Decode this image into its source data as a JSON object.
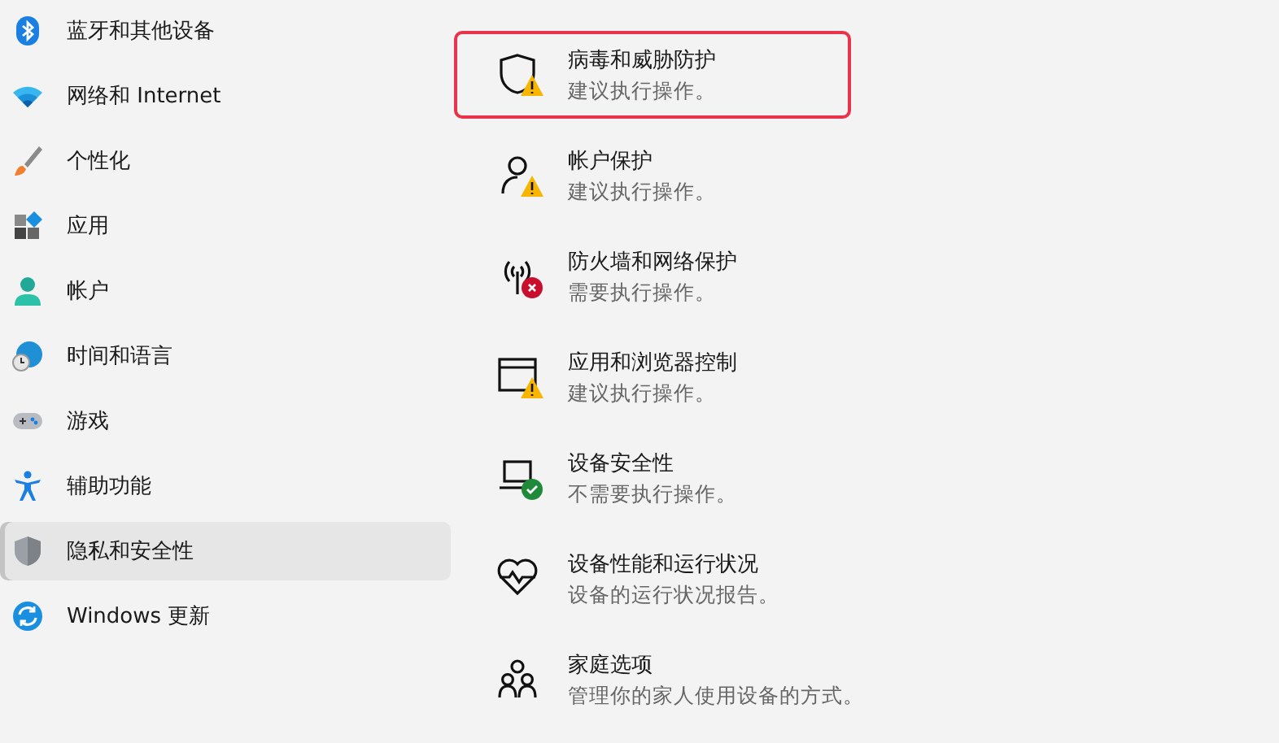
{
  "sidebar": {
    "items": [
      {
        "label": "蓝牙和其他设备",
        "kind": "bluetooth",
        "selected": false
      },
      {
        "label": "网络和 Internet",
        "kind": "wifi",
        "selected": false
      },
      {
        "label": "个性化",
        "kind": "brush",
        "selected": false
      },
      {
        "label": "应用",
        "kind": "apps",
        "selected": false
      },
      {
        "label": "帐户",
        "kind": "account",
        "selected": false
      },
      {
        "label": "时间和语言",
        "kind": "time",
        "selected": false
      },
      {
        "label": "游戏",
        "kind": "gaming",
        "selected": false
      },
      {
        "label": "辅助功能",
        "kind": "accessibility",
        "selected": false
      },
      {
        "label": "隐私和安全性",
        "kind": "privacy",
        "selected": true
      },
      {
        "label": "Windows 更新",
        "kind": "update",
        "selected": false
      }
    ]
  },
  "protection_areas": [
    {
      "title": "病毒和威胁防护",
      "subtitle": "建议执行操作。",
      "kind": "shield",
      "color": "#f7b500",
      "focused": true
    },
    {
      "title": "帐户保护",
      "subtitle": "建议执行操作。",
      "kind": "person",
      "color": "#f7b500",
      "focused": false
    },
    {
      "title": "防火墙和网络保护",
      "subtitle": "需要执行操作。",
      "kind": "antenna",
      "color": "#c8102e",
      "focused": false
    },
    {
      "title": "应用和浏览器控制",
      "subtitle": "建议执行操作。",
      "kind": "window",
      "color": "#f7b500",
      "focused": false
    },
    {
      "title": "设备安全性",
      "subtitle": "不需要执行操作。",
      "kind": "laptop",
      "color": "#1f8a3a",
      "focused": false
    },
    {
      "title": "设备性能和运行状况",
      "subtitle": "设备的运行状况报告。",
      "kind": "heart",
      "focused": false
    },
    {
      "title": "家庭选项",
      "subtitle": "管理你的家人使用设备的方式。",
      "kind": "family",
      "focused": false
    }
  ]
}
